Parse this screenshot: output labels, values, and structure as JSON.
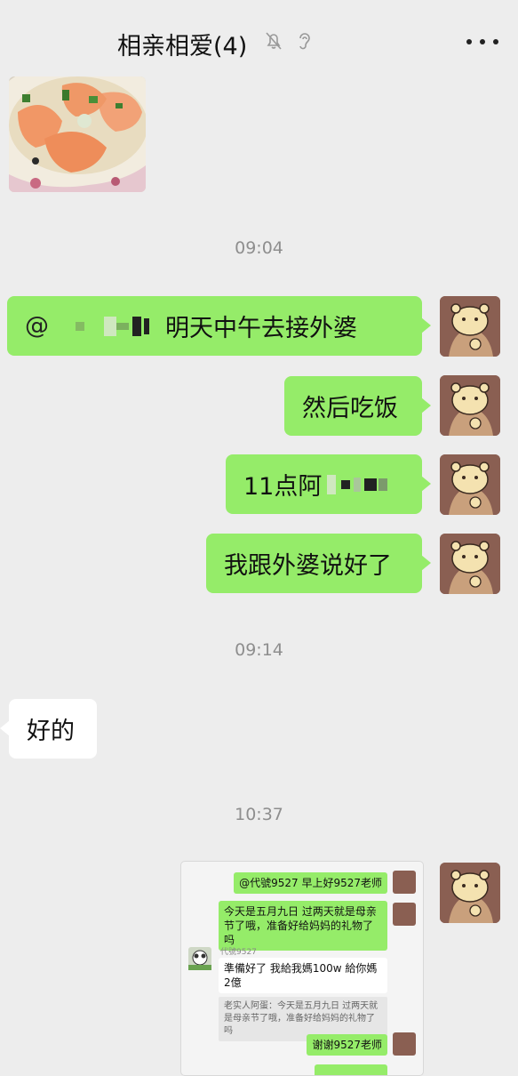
{
  "header": {
    "title": "相亲相爱(4)",
    "mute_icon": "bell-off-icon",
    "ear_icon": "earpiece-icon",
    "more_icon": "more-dots-icon"
  },
  "times": [
    "09:04",
    "09:14",
    "10:37"
  ],
  "messages_right": [
    {
      "text_tail": "明天中午去接外婆",
      "mention_prefix": "@"
    },
    {
      "text": "然后吃饭"
    },
    {
      "text_prefix": "11点阿"
    },
    {
      "text": "我跟外婆说好了"
    }
  ],
  "message_left": {
    "text": "好的"
  },
  "forwarded_screenshot": {
    "b1": "@代號9527 早上好9527老师",
    "b2": "今天是五月九日 过两天就是母亲节了哦，准备好给妈妈的礼物了吗",
    "sender_name": "代號9527",
    "reply": "準備好了 我給我媽100w 給你媽2億",
    "quote": "老实人阿蛋：今天是五月九日 过两天就是母亲节了哦，准备好给妈妈的礼物了吗",
    "b3": "谢谢9527老师"
  },
  "colors": {
    "bubble_green": "#95ec69",
    "background": "#ededed",
    "time_gray": "#8e8e8e"
  }
}
